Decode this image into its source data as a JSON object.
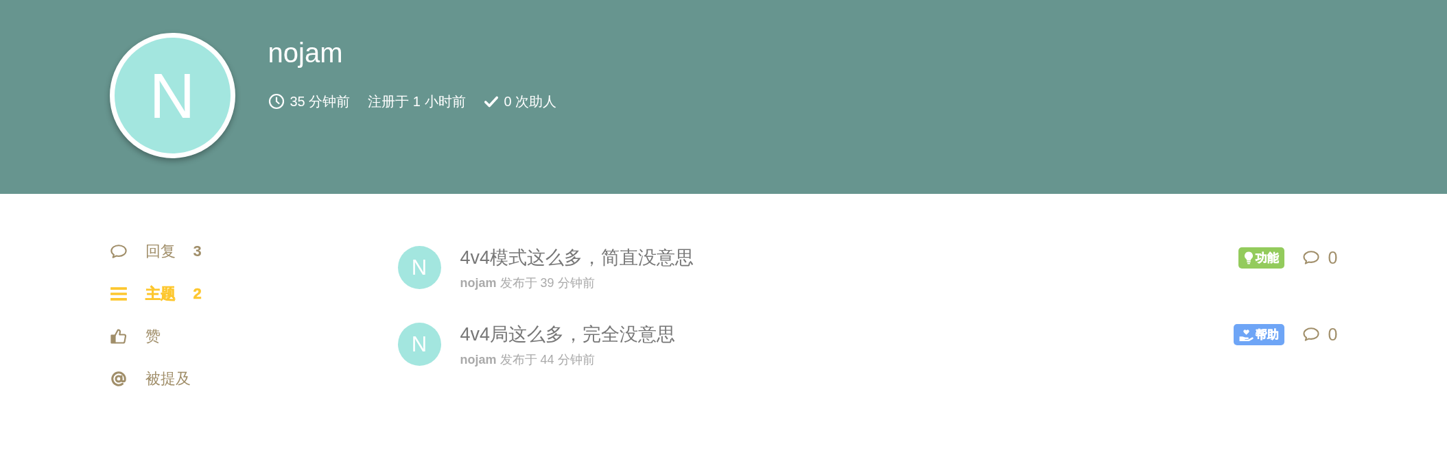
{
  "profile": {
    "avatar_letter": "N",
    "username": "nojam",
    "stats": [
      {
        "kind": "last_seen",
        "text": "35 分钟前"
      },
      {
        "kind": "joined",
        "text": "注册于 1 小时前"
      },
      {
        "kind": "helped",
        "text": "0 次助人"
      }
    ]
  },
  "sidebar": {
    "items": [
      {
        "kind": "replies",
        "label": "回复",
        "count": "3",
        "selected": false
      },
      {
        "kind": "topics",
        "label": "主题",
        "count": "2",
        "selected": true
      },
      {
        "kind": "likes",
        "label": "赞",
        "selected": false
      },
      {
        "kind": "mentions",
        "label": "被提及",
        "selected": false
      }
    ]
  },
  "topics": [
    {
      "avatar_letter": "N",
      "title": "4v4模式这么多，简直没意思",
      "meta": "**nojam** 发布于 39 分钟前",
      "tag": {
        "kind": "feature",
        "label": "功能",
        "color": "#93cb5c"
      },
      "replies": "0"
    },
    {
      "avatar_letter": "N",
      "title": "4v4局这么多，完全没意思",
      "meta": "**nojam** 发布于 44 分钟前",
      "tag": {
        "kind": "help",
        "label": "帮助",
        "color": "#6ea5f6"
      },
      "replies": "0"
    }
  ]
}
